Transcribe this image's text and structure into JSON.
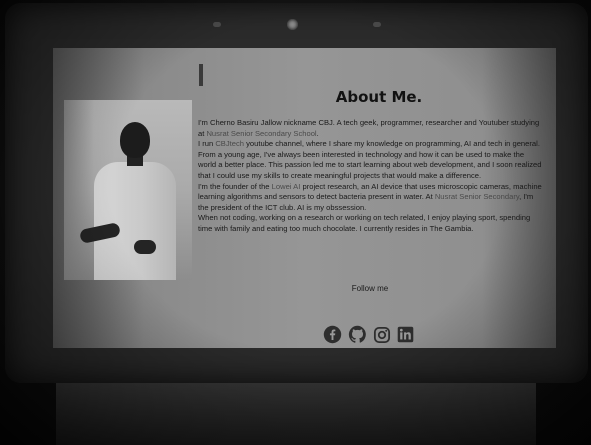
{
  "about": {
    "title": "About Me.",
    "p1_before_link": "I'm Cherno Basiru Jallow nickname CBJ. A tech geek, programmer, researcher and Youtuber studying at ",
    "p1_link": "Nusrat Senior Secondary School",
    "p1_after_link": ".",
    "p2_before_link": "I run ",
    "p2_link": "CBJtech",
    "p2_after_link": " youtube channel, where I share my knowledge on programming, AI and tech in general.",
    "p3": "From a young age, I've always been interested in technology and how it can be used to make the world a better place. This passion led me to start learning about web development, and I soon realized that I could use my skills to create meaningful projects that would make a difference.",
    "p4_before_link": "I'm the founder of the ",
    "p4_link1": "Lowei AI",
    "p4_mid": " project research, an AI device that uses microscopic cameras, machine learning algorithms and sensors to detect bacteria present in water. At ",
    "p4_link2": "Nusrat Senior Secondary",
    "p4_after_link": ", I'm the president of the ICT club. AI is my obssession.",
    "p5": "When not coding, working on a research or working on tech related, I enjoy playing sport, spending time with family and eating too much chocolate. I currently resides in The Gambia."
  },
  "follow": {
    "label": "Follow me"
  },
  "socials": [
    {
      "name": "facebook",
      "icon": "facebook-icon"
    },
    {
      "name": "github",
      "icon": "github-icon"
    },
    {
      "name": "instagram",
      "icon": "instagram-icon"
    },
    {
      "name": "linkedin",
      "icon": "linkedin-icon"
    }
  ],
  "colors": {
    "text": "#1a1a1a",
    "link": "#4a4a4a",
    "icon": "#2e2e2e"
  }
}
